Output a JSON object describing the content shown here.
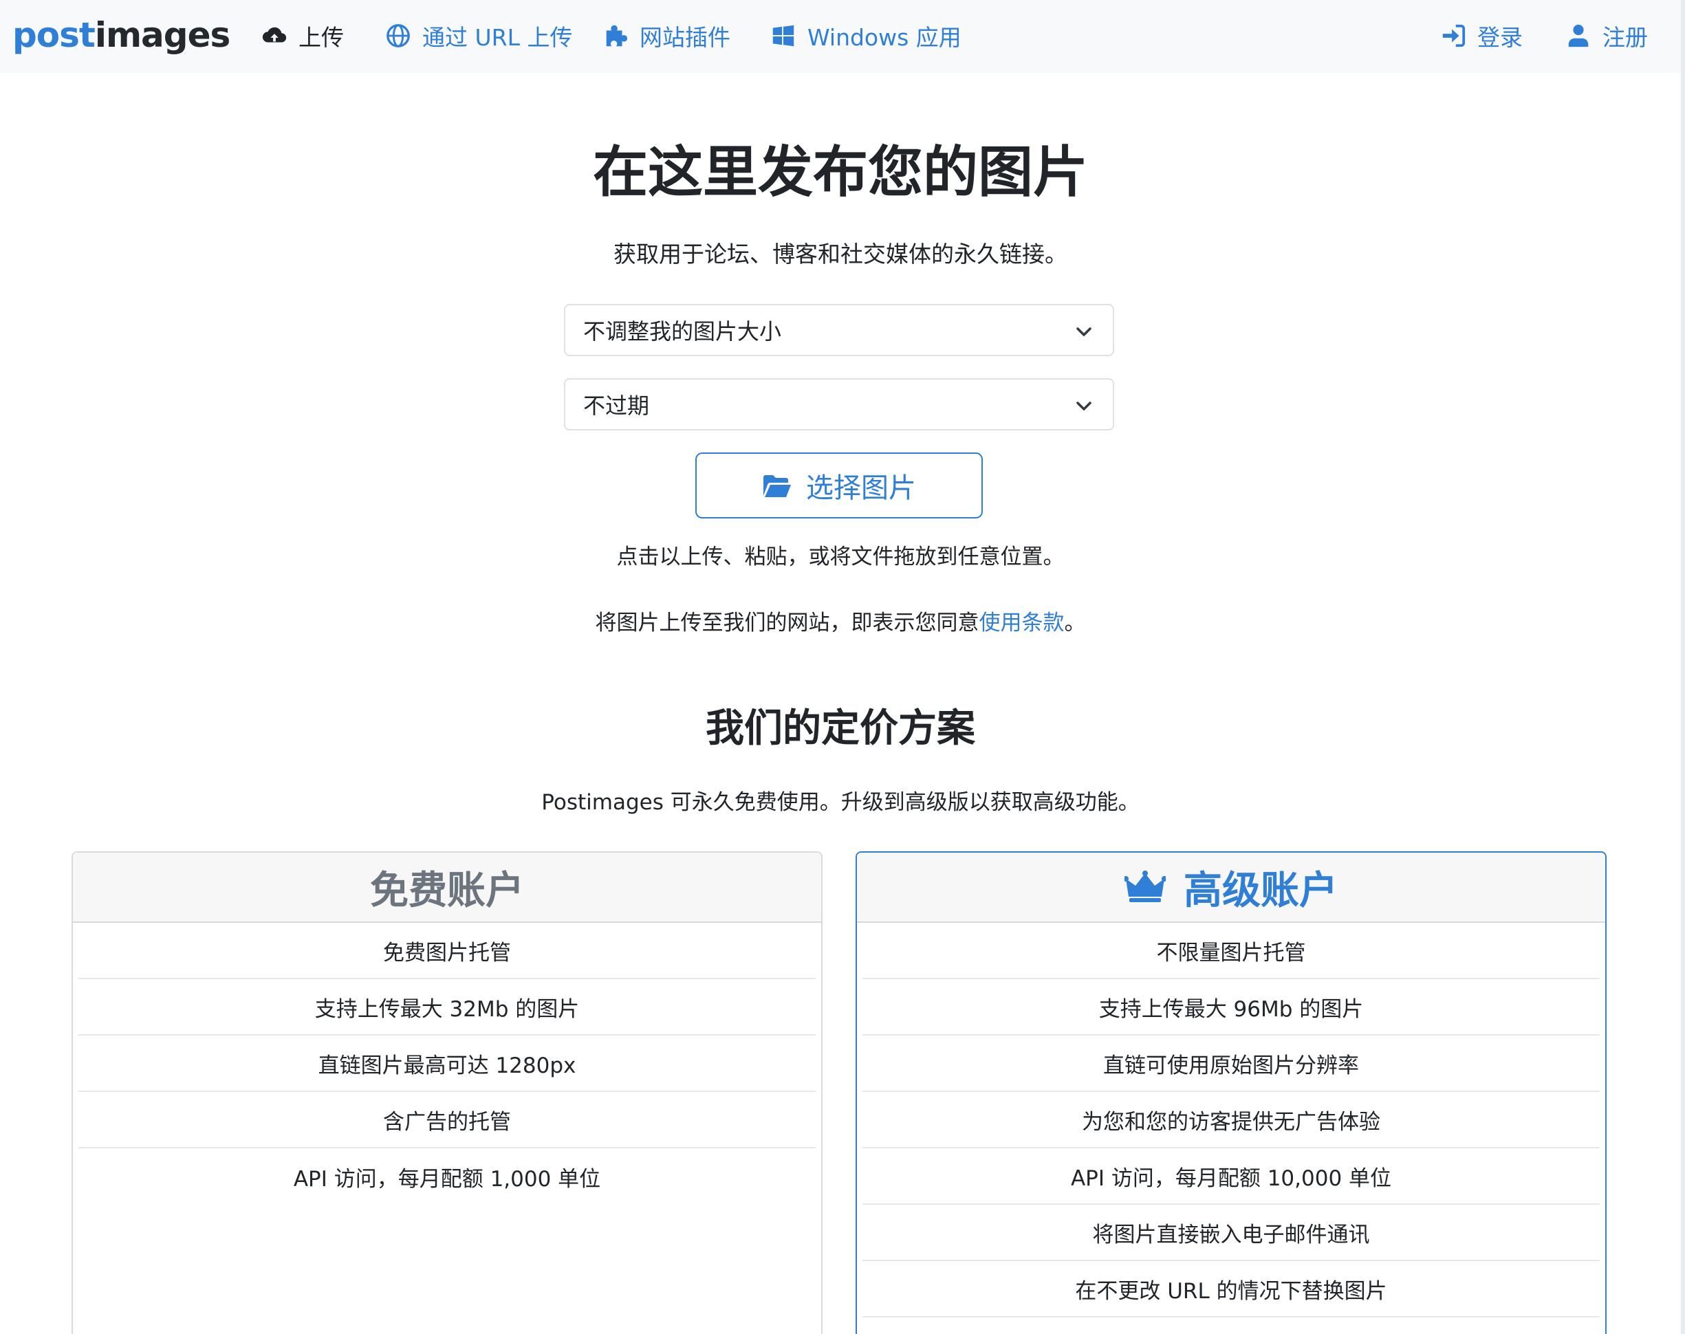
{
  "brand": {
    "part1": "post",
    "part2": "images"
  },
  "nav": {
    "upload": "上传",
    "upload_url": "通过 URL 上传",
    "plugins": "网站插件",
    "windows_app": "Windows 应用",
    "login": "登录",
    "register": "注册",
    "icons": [
      "cloud-upload-icon",
      "globe-icon",
      "puzzle-icon",
      "windows-icon",
      "sign-in-icon",
      "user-icon"
    ]
  },
  "hero": {
    "title": "在这里发布您的图片",
    "subtitle": "获取用于论坛、博客和社交媒体的永久链接。",
    "resize_select": "不调整我的图片大小",
    "expire_select": "不过期",
    "choose_button": "选择图片",
    "hint": "点击以上传、粘贴，或将文件拖放到任意位置。",
    "terms_prefix": "将图片上传至我们的网站，即表示您同意",
    "terms_link": "使用条款",
    "terms_suffix": "。"
  },
  "pricing": {
    "title": "我们的定价方案",
    "subtitle": "Postimages 可永久免费使用。升级到高级版以获取高级功能。",
    "free": {
      "title": "免费账户",
      "features": [
        "免费图片托管",
        "支持上传最大 32Mb 的图片",
        "直链图片最高可达 1280px",
        "含广告的托管",
        "API 访问，每月配额 1,000 单位"
      ]
    },
    "premium": {
      "title": "高级账户",
      "features": [
        "不限量图片托管",
        "支持上传最大 96Mb 的图片",
        "直链可使用原始图片分辨率",
        "为您和您的访客提供无广告体验",
        "API 访问，每月配额 10,000 单位",
        "将图片直接嵌入电子邮件通讯",
        "在不更改 URL 的情况下替换图片"
      ]
    }
  },
  "colors": {
    "accent": "#2f7fd6",
    "navbar_bg": "#f8f9fa",
    "text": "#212529",
    "muted": "#6c757d"
  }
}
